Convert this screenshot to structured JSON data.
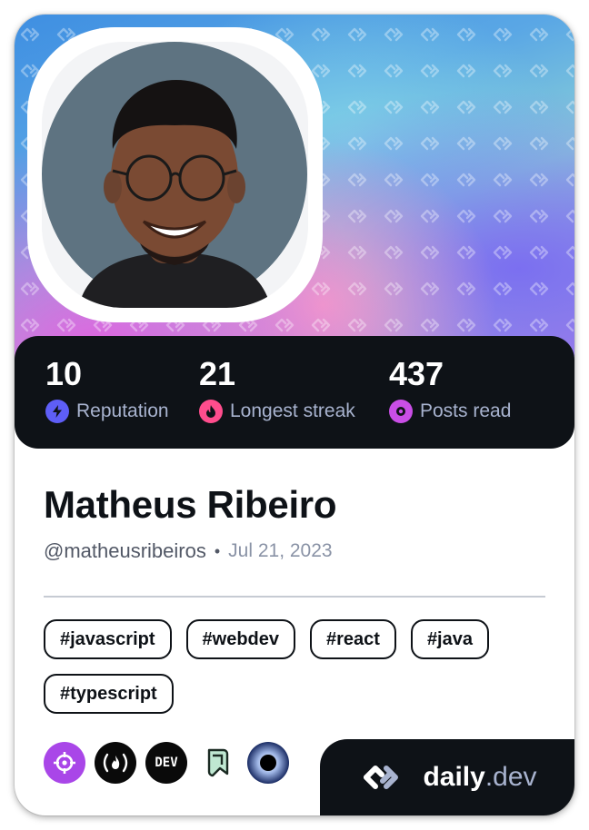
{
  "profile": {
    "name": "Matheus Ribeiro",
    "handle": "@matheusribeiros",
    "separator": "•",
    "joined": "Jul 21, 2023"
  },
  "stats": [
    {
      "value": "10",
      "label": "Reputation",
      "icon": "lightning-icon",
      "color": "#5e5ef7"
    },
    {
      "value": "21",
      "label": "Longest streak",
      "icon": "flame-icon",
      "color": "#ff4d8d"
    },
    {
      "value": "437",
      "label": "Posts read",
      "icon": "eye-icon",
      "color": "#c94ee6"
    }
  ],
  "tags": [
    "#javascript",
    "#webdev",
    "#react",
    "#java",
    "#typescript"
  ],
  "sources": [
    "target-icon",
    "fcc-icon",
    "dev-icon",
    "hashnode-icon",
    "eclipse-icon"
  ],
  "brand": {
    "main": "daily",
    "suffix": ".dev"
  },
  "colors": {
    "dark": "#0e1217",
    "accent_purple": "#a946e8"
  }
}
